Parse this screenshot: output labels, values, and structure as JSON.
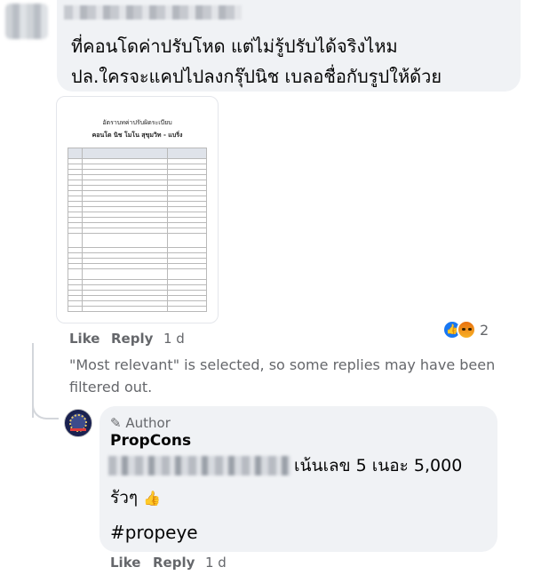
{
  "comment": {
    "line1": "ที่คอนโดค่าปรับโหด แต่ไม่รู้ปรับได้จริงไหม",
    "line2": "ปล.ใครจะแคปไปลงกรุ๊ปนิช เบลอชื่อกับรูปให้ด้วย",
    "attachment": {
      "title": "อัตราบทค่าปรับผิดระเบียบ",
      "subtitle": "คอนโด นิช โมโน สุขุมวิท - แบริ่ง",
      "row_count": 26
    },
    "actions": {
      "like": "Like",
      "reply": "Reply",
      "time": "1 d"
    },
    "reactions": {
      "count": "2",
      "icons": [
        "like-icon",
        "angry-icon"
      ]
    }
  },
  "filter_notice": "\"Most relevant\" is selected, so some replies may have been filtered out.",
  "reply": {
    "author_tag": "Author",
    "author_name": "PropCons",
    "text_line1": "เน้นเลข 5 เนอะ 5,000",
    "text_line2": "รัวๆ",
    "emoji": "thumbs-up-icon",
    "hashtag": "#propeye",
    "actions": {
      "like": "Like",
      "reply": "Reply",
      "time": "1 d"
    }
  },
  "colors": {
    "bubble": "#f0f2f5",
    "meta": "#65676b",
    "text": "#050505",
    "like_blue": "#1877f2"
  }
}
